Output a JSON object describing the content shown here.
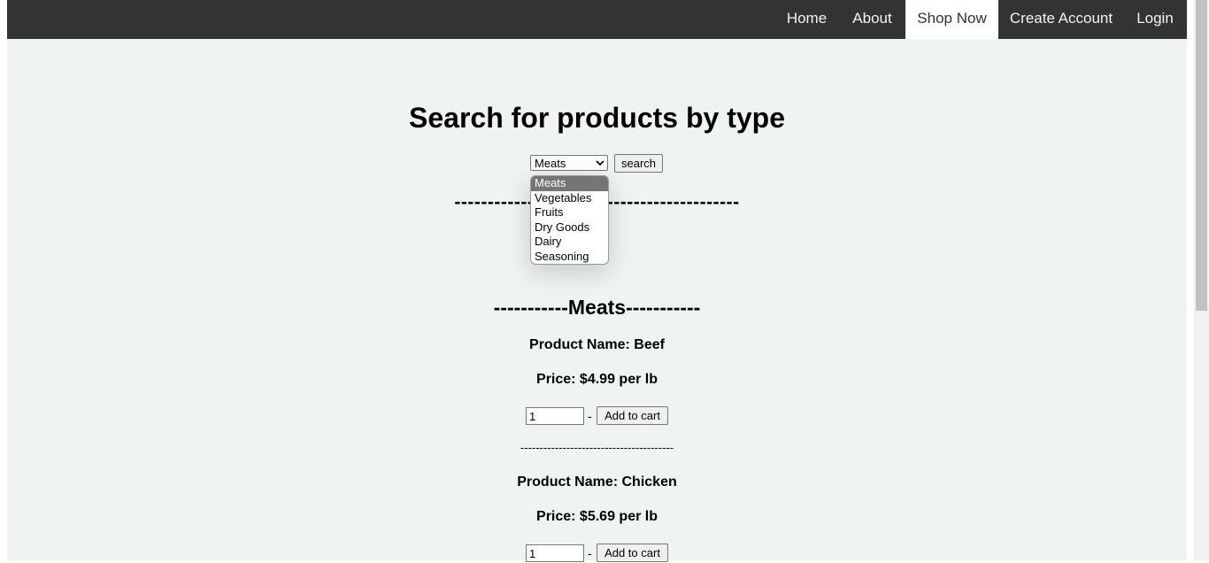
{
  "nav": {
    "items": [
      {
        "label": "Home",
        "active": false
      },
      {
        "label": "About",
        "active": false
      },
      {
        "label": "Shop Now",
        "active": true
      },
      {
        "label": "Create Account",
        "active": false
      },
      {
        "label": "Login",
        "active": false
      }
    ]
  },
  "search": {
    "title": "Search for products by type",
    "selected": "Meats",
    "button_label": "search",
    "options": [
      "Meats",
      "Vegetables",
      "Fruits",
      "Dry Goods",
      "Dairy",
      "Seasoning"
    ],
    "divider": "-------------------------------------------"
  },
  "category": {
    "title": "-----------Meats-----------"
  },
  "products": [
    {
      "name": "Product Name: Beef",
      "price": "Price: $4.99 per lb",
      "quantity": "1",
      "separator": "-",
      "button_label": "Add to cart"
    },
    {
      "name": "Product Name: Chicken",
      "price": "Price: $5.69 per lb",
      "quantity": "1",
      "separator": "-",
      "button_label": "Add to cart"
    }
  ],
  "product_divider": "----------------------------------------",
  "icons": {
    "select_chevron": "chevron-down-icon"
  },
  "colors": {
    "nav_bg": "#333333",
    "page_bg": "#eff4f3",
    "active_tab_bg": "#ffffff",
    "option_selected_bg": "#757575"
  }
}
